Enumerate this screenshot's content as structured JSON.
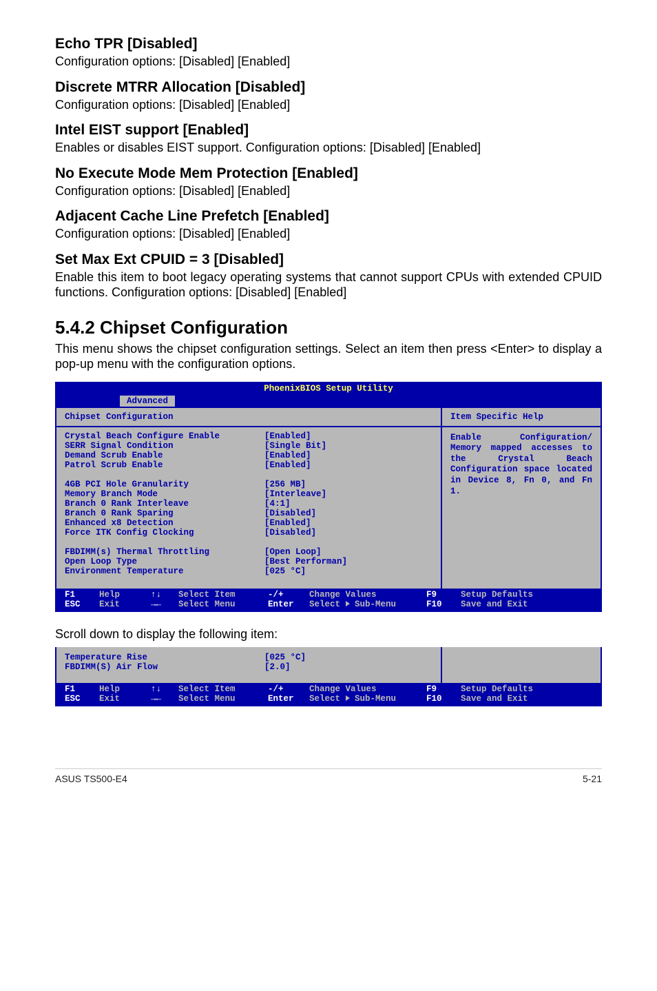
{
  "settings": [
    {
      "title": "Echo TPR [Disabled]",
      "desc": "Configuration options: [Disabled] [Enabled]"
    },
    {
      "title": "Discrete MTRR Allocation [Disabled]",
      "desc": "Configuration options: [Disabled] [Enabled]"
    },
    {
      "title": "Intel EIST support [Enabled]",
      "desc": "Enables or disables EIST support. Configuration options: [Disabled] [Enabled]"
    },
    {
      "title": "No Execute Mode Mem Protection [Enabled]",
      "desc": "Configuration options: [Disabled] [Enabled]"
    },
    {
      "title": "Adjacent Cache Line Prefetch [Enabled]",
      "desc": "Configuration options: [Disabled] [Enabled]"
    },
    {
      "title": "Set Max Ext CPUID = 3 [Disabled]",
      "desc": "Enable this item to boot legacy operating systems that cannot support CPUs with extended CPUID functions. Configuration options: [Disabled] [Enabled]"
    }
  ],
  "section": {
    "heading": "5.4.2 Chipset Configuration",
    "intro": "This menu shows the chipset configuration settings. Select an item then press <Enter> to display a pop-up menu with the configuration options."
  },
  "bios": {
    "title": "PhoenixBIOS Setup Utility",
    "active_tab": "Advanced",
    "panel_title": "Chipset Configuration",
    "help_title": "Item Specific Help",
    "help_text": "Enable Configuration/ Memory mapped accesses to the Crystal Beach Configuration space located in\nDevice 8, Fn 0, and Fn 1.",
    "groups": [
      [
        {
          "label": "Crystal Beach Configure Enable",
          "value": "[Enabled]"
        },
        {
          "label": "SERR Signal Condition",
          "value": "[Single Bit]"
        },
        {
          "label": "Demand Scrub Enable",
          "value": "[Enabled]"
        },
        {
          "label": "Patrol Scrub Enable",
          "value": "[Enabled]"
        }
      ],
      [
        {
          "label": "4GB PCI Hole Granularity",
          "value": "[256 MB]"
        },
        {
          "label": "Memory Branch Mode",
          "value": "[Interleave]"
        },
        {
          "label": "Branch 0 Rank Interleave",
          "value": "[4:1]"
        },
        {
          "label": "Branch 0 Rank Sparing",
          "value": "[Disabled]"
        },
        {
          "label": "Enhanced x8 Detection",
          "value": "[Enabled]"
        },
        {
          "label": "Force ITK Config Clocking",
          "value": "[Disabled]"
        }
      ],
      [
        {
          "label": "FBDIMM(s) Thermal Throttling",
          "value": "[Open Loop]"
        },
        {
          "label": "Open Loop Type",
          "value": "[Best Performan]"
        },
        {
          "label": "Environment Temperature",
          "value": "[025 °C]"
        }
      ]
    ],
    "footer": {
      "f1": "F1",
      "help": "Help",
      "arrows1": "↑↓",
      "select_item": "Select Item",
      "minusplus": "-/+",
      "change_values": "Change Values",
      "f9": "F9",
      "setup_defaults": "Setup Defaults",
      "esc": "ESC",
      "exit": "Exit",
      "arrows2": "→←",
      "select_menu": "Select Menu",
      "enter": "Enter",
      "select_sub": "Select   Sub-Menu",
      "f10": "F10",
      "save_exit": "Save and Exit"
    }
  },
  "scroll_caption": "Scroll down to display the following item:",
  "bios2": {
    "rows": [
      {
        "label": "Temperature Rise",
        "value": "[025 °C]"
      },
      {
        "label": "FBDIMM(S) Air Flow",
        "value": "[2.0]"
      }
    ]
  },
  "page_footer": {
    "left": "ASUS TS500-E4",
    "right": "5-21"
  }
}
